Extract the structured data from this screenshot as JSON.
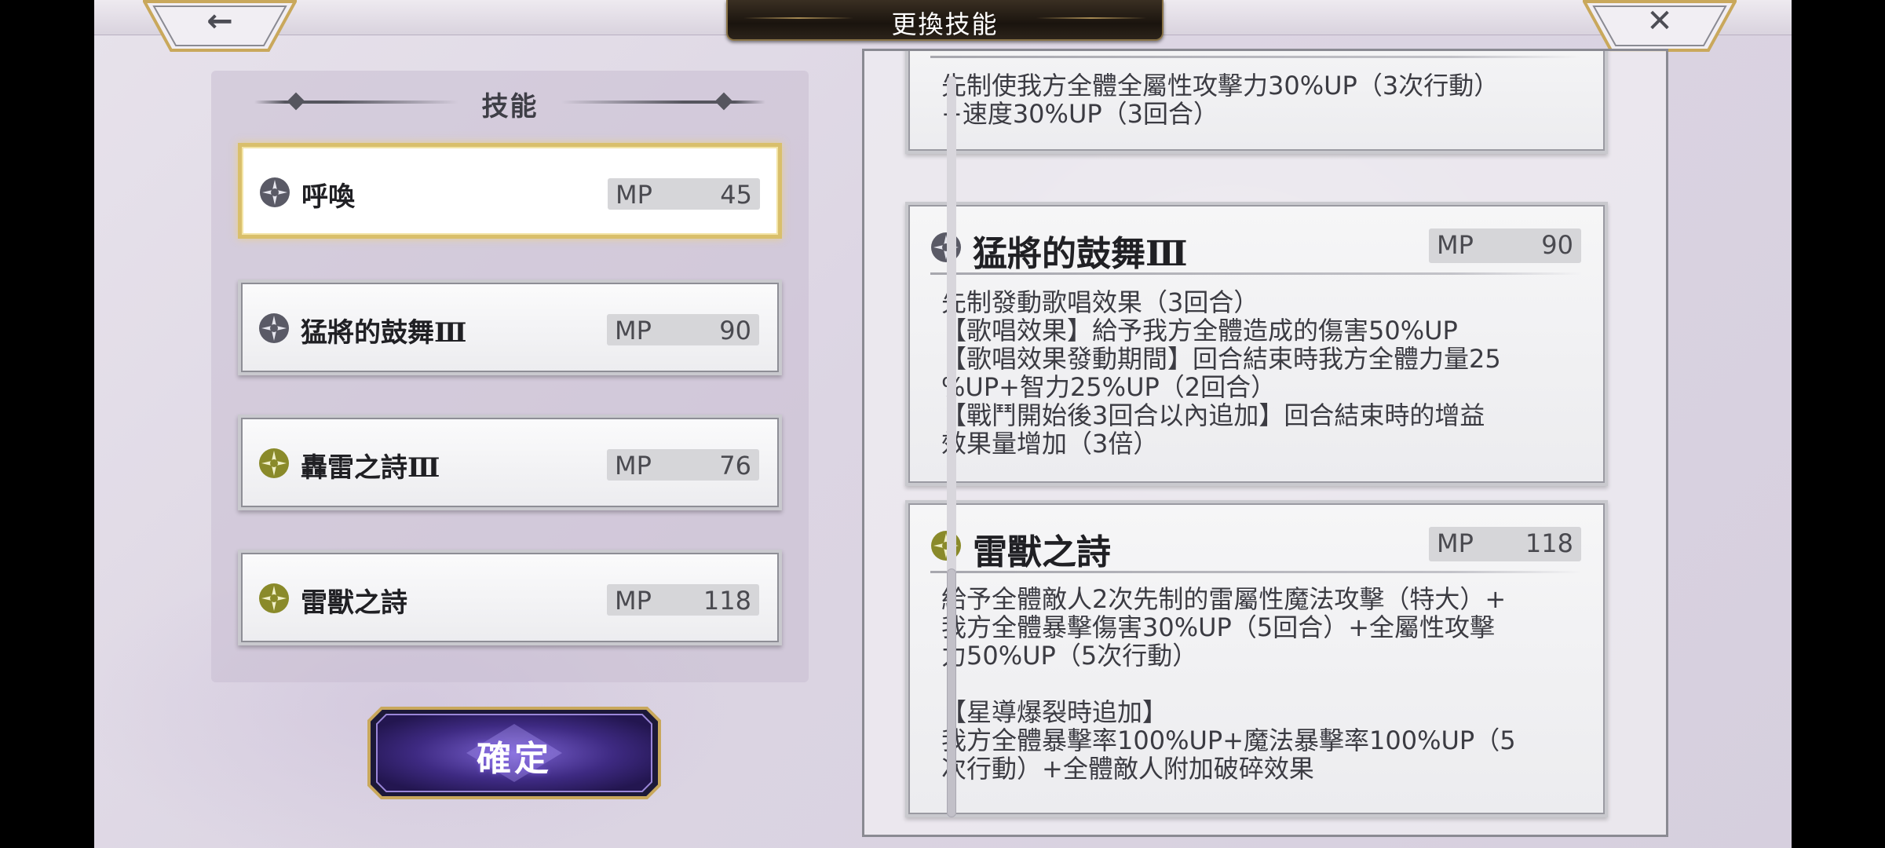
{
  "header": {
    "title": "更換技能",
    "back_icon": "←",
    "close_icon": "✕"
  },
  "left_panel": {
    "heading": "技能",
    "skills": [
      {
        "name": "呼喚",
        "mp_label": "MP",
        "mp": "45",
        "element": "dark",
        "selected": true
      },
      {
        "name": "猛將的鼓舞Ⅲ",
        "mp_label": "MP",
        "mp": "90",
        "element": "dark",
        "selected": false
      },
      {
        "name": "轟雷之詩Ⅲ",
        "mp_label": "MP",
        "mp": "76",
        "element": "thunder",
        "selected": false
      },
      {
        "name": "雷獸之詩",
        "mp_label": "MP",
        "mp": "118",
        "element": "thunder",
        "selected": false
      }
    ],
    "confirm_label": "確定"
  },
  "right_panel": {
    "partial_card": {
      "desc": "先制使我方全體全屬性攻擊力30%UP（3次行動）\n+速度30%UP（3回合）"
    },
    "cards": [
      {
        "name": "猛將的鼓舞Ⅲ",
        "mp_label": "MP",
        "mp": "90",
        "element": "dark",
        "desc": "先制發動歌唱效果（3回合）\n【歌唱效果】給予我方全體造成的傷害50%UP\n【歌唱效果發動期間】回合結束時我方全體力量25\n%UP+智力25%UP（2回合）\n【戰鬥開始後3回合以內追加】回合結束時的增益\n效果量增加（3倍）"
      },
      {
        "name": "雷獸之詩",
        "mp_label": "MP",
        "mp": "118",
        "element": "thunder",
        "desc": "給予全體敵人2次先制的雷屬性魔法攻擊（特大）+\n我方全體暴擊傷害30%UP（5回合）+全屬性攻擊\n力50%UP（5次行動）\n\n【星導爆裂時追加】\n我方全體暴擊率100%UP+魔法暴擊率100%UP（5\n次行動）+全體敵人附加破碎效果"
      }
    ]
  },
  "colors": {
    "dark_icon": "#5a5a66",
    "thunder_icon": "#8a8a2a",
    "selected_border": "#d9bf6b",
    "confirm_purple": "#4b3590"
  }
}
